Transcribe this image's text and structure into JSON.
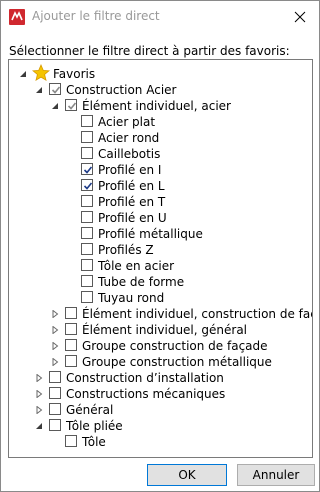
{
  "window": {
    "title": "Ajouter le filtre direct"
  },
  "instruction": "Sélectionner le filtre direct à partir des favoris:",
  "tree": [
    {
      "label": "Favoris",
      "icon": "star-icon",
      "expander": "expanded",
      "checkbox": false,
      "level": 0,
      "checked": false
    },
    {
      "label": "Construction Acier",
      "expander": "expanded",
      "checkbox": true,
      "level": 1,
      "checked": "gray"
    },
    {
      "label": "Élément individuel, acier",
      "expander": "expanded",
      "checkbox": true,
      "level": 2,
      "checked": "gray"
    },
    {
      "label": "Acier plat",
      "expander": "none",
      "checkbox": true,
      "level": 3,
      "checked": false
    },
    {
      "label": "Acier rond",
      "expander": "none",
      "checkbox": true,
      "level": 3,
      "checked": false
    },
    {
      "label": "Caillebotis",
      "expander": "none",
      "checkbox": true,
      "level": 3,
      "checked": false
    },
    {
      "label": "Profilé en I",
      "expander": "none",
      "checkbox": true,
      "level": 3,
      "checked": true
    },
    {
      "label": "Profilé en L",
      "expander": "none",
      "checkbox": true,
      "level": 3,
      "checked": true
    },
    {
      "label": "Profilé en T",
      "expander": "none",
      "checkbox": true,
      "level": 3,
      "checked": false
    },
    {
      "label": "Profilé en U",
      "expander": "none",
      "checkbox": true,
      "level": 3,
      "checked": false
    },
    {
      "label": "Profilé métallique",
      "expander": "none",
      "checkbox": true,
      "level": 3,
      "checked": false
    },
    {
      "label": "Profilés Z",
      "expander": "none",
      "checkbox": true,
      "level": 3,
      "checked": false
    },
    {
      "label": "Tôle en acier",
      "expander": "none",
      "checkbox": true,
      "level": 3,
      "checked": false
    },
    {
      "label": "Tube de forme",
      "expander": "none",
      "checkbox": true,
      "level": 3,
      "checked": false
    },
    {
      "label": "Tuyau rond",
      "expander": "none",
      "checkbox": true,
      "level": 3,
      "checked": false
    },
    {
      "label": "Élément individuel, construction de façade",
      "expander": "collapsed",
      "checkbox": true,
      "level": 2,
      "checked": false
    },
    {
      "label": "Élément individuel, général",
      "expander": "collapsed",
      "checkbox": true,
      "level": 2,
      "checked": false
    },
    {
      "label": "Groupe construction de façade",
      "expander": "collapsed",
      "checkbox": true,
      "level": 2,
      "checked": false
    },
    {
      "label": "Groupe construction métallique",
      "expander": "collapsed",
      "checkbox": true,
      "level": 2,
      "checked": false
    },
    {
      "label": "Construction d’installation",
      "expander": "collapsed",
      "checkbox": true,
      "level": 1,
      "checked": false
    },
    {
      "label": "Constructions mécaniques",
      "expander": "collapsed",
      "checkbox": true,
      "level": 1,
      "checked": false
    },
    {
      "label": "Général",
      "expander": "collapsed",
      "checkbox": true,
      "level": 1,
      "checked": false
    },
    {
      "label": "Tôle pliée",
      "expander": "expanded",
      "checkbox": true,
      "level": 1,
      "checked": false
    },
    {
      "label": "Tôle",
      "expander": "none",
      "checkbox": true,
      "level": 2,
      "checked": false
    }
  ],
  "buttons": {
    "ok": "OK",
    "cancel": "Annuler"
  },
  "colors": {
    "app_icon": "#d0282f",
    "check": "#1f3c88",
    "gray_check": "#8a8a8a",
    "star": "#f5c400"
  }
}
